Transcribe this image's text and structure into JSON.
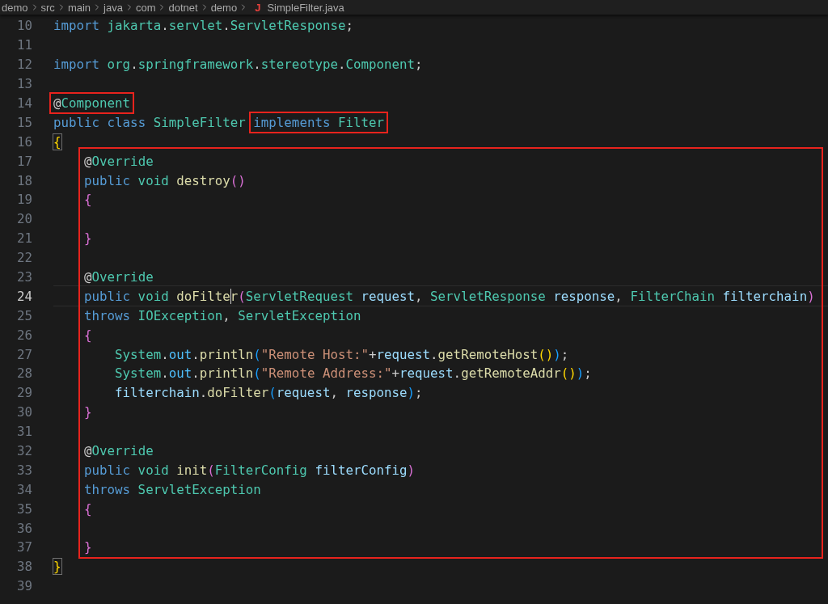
{
  "breadcrumb": {
    "items": [
      "demo",
      "src",
      "main",
      "java",
      "com",
      "dotnet",
      "demo"
    ],
    "file_icon": "J",
    "file": "SimpleFilter.java"
  },
  "blocks": [
    {
      "kind": "plain",
      "lines": [
        {
          "number": "10",
          "current": false,
          "segments": [
            {
              "kind": "plain",
              "tokens": [
                {
                  "t": "import",
                  "kind": "kw"
                },
                {
                  "t": " jakarta",
                  "kind": "type"
                },
                {
                  "t": ".",
                  "kind": "punc"
                },
                {
                  "t": "servlet",
                  "kind": "type"
                },
                {
                  "t": ".",
                  "kind": "punc"
                },
                {
                  "t": "ServletResponse",
                  "kind": "type"
                },
                {
                  "t": ";",
                  "kind": "punc"
                }
              ]
            }
          ]
        },
        {
          "number": "11",
          "current": false
        },
        {
          "number": "12",
          "current": false,
          "segments": [
            {
              "kind": "plain",
              "tokens": [
                {
                  "t": "import",
                  "kind": "kw"
                },
                {
                  "t": " org",
                  "kind": "type"
                },
                {
                  "t": ".",
                  "kind": "punc"
                },
                {
                  "t": "springframework",
                  "kind": "type"
                },
                {
                  "t": ".",
                  "kind": "punc"
                },
                {
                  "t": "stereotype",
                  "kind": "type"
                },
                {
                  "t": ".",
                  "kind": "punc"
                },
                {
                  "t": "Component",
                  "kind": "type"
                },
                {
                  "t": ";",
                  "kind": "punc"
                }
              ]
            }
          ]
        },
        {
          "number": "13",
          "current": false
        },
        {
          "number": "14",
          "current": false,
          "segments": [
            {
              "kind": "highlighted",
              "tokens": [
                {
                  "t": "@",
                  "kind": "punc"
                },
                {
                  "t": "Component",
                  "kind": "type"
                }
              ]
            }
          ]
        },
        {
          "number": "15",
          "current": false,
          "segments": [
            {
              "kind": "plain",
              "tokens": [
                {
                  "t": "public",
                  "kind": "kw"
                },
                {
                  "t": " class",
                  "kind": "kw"
                },
                {
                  "t": " SimpleFilter ",
                  "kind": "type"
                }
              ]
            },
            {
              "kind": "highlighted",
              "tokens": [
                {
                  "t": "implements",
                  "kind": "kw"
                },
                {
                  "t": " Filter",
                  "kind": "type"
                }
              ]
            }
          ]
        },
        {
          "number": "16",
          "current": false,
          "segments": [
            {
              "kind": "plain",
              "tokens": [
                {
                  "t": "{",
                  "kind": "bracket_match"
                }
              ]
            }
          ]
        }
      ]
    },
    {
      "kind": "highlighted",
      "lines": [
        {
          "number": "17",
          "current": false,
          "segments": [
            {
              "kind": "plain",
              "tokens": [
                {
                  "t": "    @",
                  "kind": "punc"
                },
                {
                  "t": "Override",
                  "kind": "type"
                }
              ]
            }
          ]
        },
        {
          "number": "18",
          "current": false,
          "segments": [
            {
              "kind": "plain",
              "tokens": [
                {
                  "t": "    public",
                  "kind": "kw"
                },
                {
                  "t": " void",
                  "kind": "type"
                },
                {
                  "t": " destroy",
                  "kind": "fn"
                },
                {
                  "t": "()",
                  "kind": "b2"
                }
              ]
            }
          ]
        },
        {
          "number": "19",
          "current": false,
          "segments": [
            {
              "kind": "plain",
              "tokens": [
                {
                  "t": "    {",
                  "kind": "b2"
                }
              ]
            }
          ]
        },
        {
          "number": "20",
          "current": false
        },
        {
          "number": "21",
          "current": false,
          "segments": [
            {
              "kind": "plain",
              "tokens": [
                {
                  "t": "    }",
                  "kind": "b2"
                }
              ]
            }
          ]
        },
        {
          "number": "22",
          "current": false
        },
        {
          "number": "23",
          "current": false,
          "segments": [
            {
              "kind": "plain",
              "tokens": [
                {
                  "t": "    @",
                  "kind": "punc"
                },
                {
                  "t": "Override",
                  "kind": "type"
                }
              ]
            }
          ]
        },
        {
          "number": "24",
          "current": true,
          "segments": [
            {
              "kind": "plain",
              "tokens": [
                {
                  "t": "    public",
                  "kind": "kw"
                },
                {
                  "t": " void",
                  "kind": "type"
                },
                {
                  "t": " doFilte",
                  "kind": "fn_caret"
                },
                {
                  "t": "r",
                  "kind": "fn"
                },
                {
                  "t": "(",
                  "kind": "b2"
                },
                {
                  "t": "ServletRequest",
                  "kind": "type"
                },
                {
                  "t": " request",
                  "kind": "var"
                },
                {
                  "t": ", ",
                  "kind": "punc"
                },
                {
                  "t": "ServletResponse",
                  "kind": "type"
                },
                {
                  "t": " response",
                  "kind": "var"
                },
                {
                  "t": ", ",
                  "kind": "punc"
                },
                {
                  "t": "FilterChain",
                  "kind": "type"
                },
                {
                  "t": " filterchain",
                  "kind": "var"
                },
                {
                  "t": ")",
                  "kind": "b2"
                }
              ]
            }
          ]
        },
        {
          "number": "25",
          "current": false,
          "segments": [
            {
              "kind": "plain",
              "tokens": [
                {
                  "t": "    throws",
                  "kind": "kw"
                },
                {
                  "t": " IOException",
                  "kind": "type"
                },
                {
                  "t": ", ",
                  "kind": "punc"
                },
                {
                  "t": "ServletException",
                  "kind": "type"
                }
              ]
            }
          ]
        },
        {
          "number": "26",
          "current": false,
          "segments": [
            {
              "kind": "plain",
              "tokens": [
                {
                  "t": "    {",
                  "kind": "b2"
                }
              ]
            }
          ]
        },
        {
          "number": "27",
          "current": false,
          "segments": [
            {
              "kind": "plain",
              "tokens": [
                {
                  "t": "        System",
                  "kind": "type"
                },
                {
                  "t": ".",
                  "kind": "punc"
                },
                {
                  "t": "out",
                  "kind": "const"
                },
                {
                  "t": ".",
                  "kind": "punc"
                },
                {
                  "t": "println",
                  "kind": "fn"
                },
                {
                  "t": "(",
                  "kind": "b3"
                },
                {
                  "t": "\"Remote Host:\"",
                  "kind": "str"
                },
                {
                  "t": "+",
                  "kind": "punc"
                },
                {
                  "t": "request",
                  "kind": "var"
                },
                {
                  "t": ".",
                  "kind": "punc"
                },
                {
                  "t": "getRemoteHost",
                  "kind": "fn"
                },
                {
                  "t": "()",
                  "kind": "b1"
                },
                {
                  "t": ")",
                  "kind": "b3"
                },
                {
                  "t": ";",
                  "kind": "punc"
                }
              ]
            }
          ]
        },
        {
          "number": "28",
          "current": false,
          "segments": [
            {
              "kind": "plain",
              "tokens": [
                {
                  "t": "        System",
                  "kind": "type"
                },
                {
                  "t": ".",
                  "kind": "punc"
                },
                {
                  "t": "out",
                  "kind": "const"
                },
                {
                  "t": ".",
                  "kind": "punc"
                },
                {
                  "t": "println",
                  "kind": "fn"
                },
                {
                  "t": "(",
                  "kind": "b3"
                },
                {
                  "t": "\"Remote Address:\"",
                  "kind": "str"
                },
                {
                  "t": "+",
                  "kind": "punc"
                },
                {
                  "t": "request",
                  "kind": "var"
                },
                {
                  "t": ".",
                  "kind": "punc"
                },
                {
                  "t": "getRemoteAddr",
                  "kind": "fn"
                },
                {
                  "t": "()",
                  "kind": "b1"
                },
                {
                  "t": ")",
                  "kind": "b3"
                },
                {
                  "t": ";",
                  "kind": "punc"
                }
              ]
            }
          ]
        },
        {
          "number": "29",
          "current": false,
          "segments": [
            {
              "kind": "plain",
              "tokens": [
                {
                  "t": "        filterchain",
                  "kind": "var"
                },
                {
                  "t": ".",
                  "kind": "punc"
                },
                {
                  "t": "doFilter",
                  "kind": "fn"
                },
                {
                  "t": "(",
                  "kind": "b3"
                },
                {
                  "t": "request",
                  "kind": "var"
                },
                {
                  "t": ", ",
                  "kind": "punc"
                },
                {
                  "t": "response",
                  "kind": "var"
                },
                {
                  "t": ")",
                  "kind": "b3"
                },
                {
                  "t": ";",
                  "kind": "punc"
                }
              ]
            }
          ]
        },
        {
          "number": "30",
          "current": false,
          "segments": [
            {
              "kind": "plain",
              "tokens": [
                {
                  "t": "    }",
                  "kind": "b2"
                }
              ]
            }
          ]
        },
        {
          "number": "31",
          "current": false
        },
        {
          "number": "32",
          "current": false,
          "segments": [
            {
              "kind": "plain",
              "tokens": [
                {
                  "t": "    @",
                  "kind": "punc"
                },
                {
                  "t": "Override",
                  "kind": "type"
                }
              ]
            }
          ]
        },
        {
          "number": "33",
          "current": false,
          "segments": [
            {
              "kind": "plain",
              "tokens": [
                {
                  "t": "    public",
                  "kind": "kw"
                },
                {
                  "t": " void",
                  "kind": "type"
                },
                {
                  "t": " init",
                  "kind": "fn"
                },
                {
                  "t": "(",
                  "kind": "b2"
                },
                {
                  "t": "FilterConfig",
                  "kind": "type"
                },
                {
                  "t": " filterConfig",
                  "kind": "var"
                },
                {
                  "t": ")",
                  "kind": "b2"
                }
              ]
            }
          ]
        },
        {
          "number": "34",
          "current": false,
          "segments": [
            {
              "kind": "plain",
              "tokens": [
                {
                  "t": "    throws",
                  "kind": "kw"
                },
                {
                  "t": " ServletException",
                  "kind": "type"
                }
              ]
            }
          ]
        },
        {
          "number": "35",
          "current": false,
          "segments": [
            {
              "kind": "plain",
              "tokens": [
                {
                  "t": "    {",
                  "kind": "b2"
                }
              ]
            }
          ]
        },
        {
          "number": "36",
          "current": false
        },
        {
          "number": "37",
          "current": false,
          "segments": [
            {
              "kind": "plain",
              "tokens": [
                {
                  "t": "    }",
                  "kind": "b2"
                }
              ]
            }
          ]
        }
      ]
    },
    {
      "kind": "plain",
      "lines": [
        {
          "number": "38",
          "current": false,
          "segments": [
            {
              "kind": "plain",
              "tokens": [
                {
                  "t": "}",
                  "kind": "bracket_match"
                }
              ]
            }
          ]
        },
        {
          "number": "39",
          "current": false
        }
      ]
    }
  ]
}
